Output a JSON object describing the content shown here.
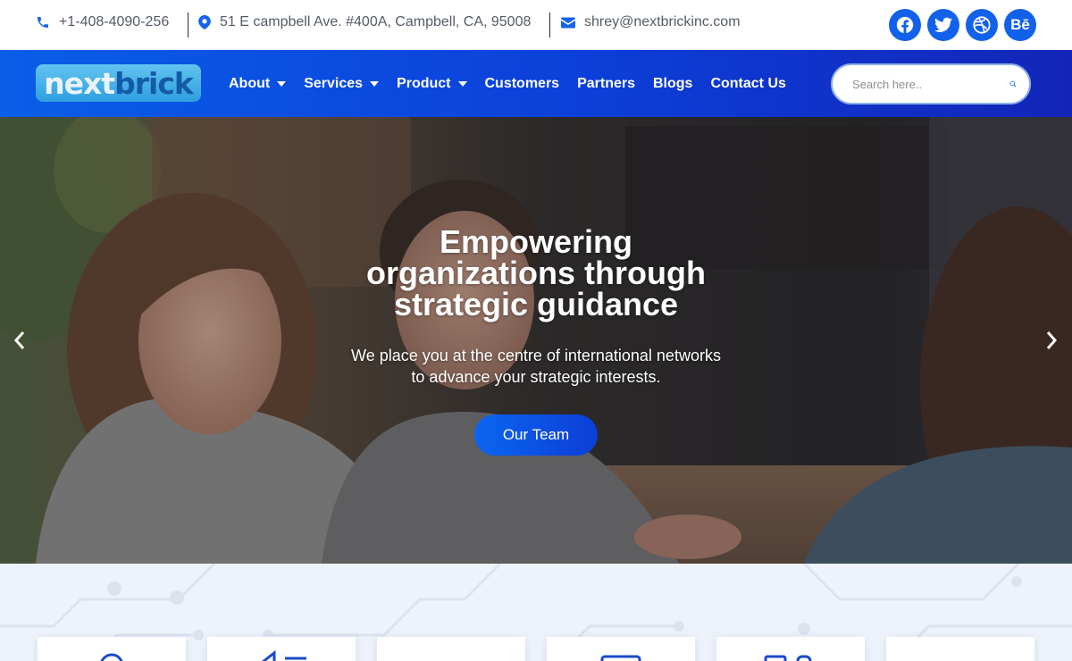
{
  "colors": {
    "accent": "#1261ea",
    "nav_gradient_start": "#0a5ee8",
    "nav_gradient_end": "#1325b8",
    "section_bg": "#eef3fb"
  },
  "contact": {
    "phone": "+1-408-4090-256",
    "address": "51 E campbell Ave. #400A, Campbell, CA, 95008",
    "email": "shrey@nextbrickinc.com",
    "phone_icon": "phone-icon",
    "address_icon": "map-pin-icon",
    "email_icon": "envelope-icon"
  },
  "socials": [
    {
      "name": "facebook",
      "icon": "facebook-icon"
    },
    {
      "name": "twitter",
      "icon": "twitter-icon"
    },
    {
      "name": "dribbble",
      "icon": "dribbble-icon"
    },
    {
      "name": "behance",
      "icon": "behance-icon",
      "glyph": "Bē"
    }
  ],
  "logo": {
    "part1": "next",
    "part2": "brick"
  },
  "nav": {
    "about": "About",
    "services": "Services",
    "product": "Product",
    "customers": "Customers",
    "partners": "Partners",
    "blogs": "Blogs",
    "contact": "Contact Us"
  },
  "search": {
    "placeholder": "Search here..",
    "icon": "search-icon"
  },
  "hero": {
    "title_line1": "Empowering",
    "title_line2": "organizations through",
    "title_line3": "strategic guidance",
    "subtitle_line1": "We place you at the centre of international networks",
    "subtitle_line2": "to advance your strategic interests.",
    "cta": "Our Team",
    "prev_icon": "chevron-left-icon",
    "next_icon": "chevron-right-icon"
  },
  "service_cards": [
    {
      "icon": "gear-icon"
    },
    {
      "icon": "megaphone-icon"
    },
    {
      "icon": "blank"
    },
    {
      "icon": "monitor-icon"
    },
    {
      "icon": "devices-icon"
    },
    {
      "icon": "cloud-icon"
    }
  ]
}
